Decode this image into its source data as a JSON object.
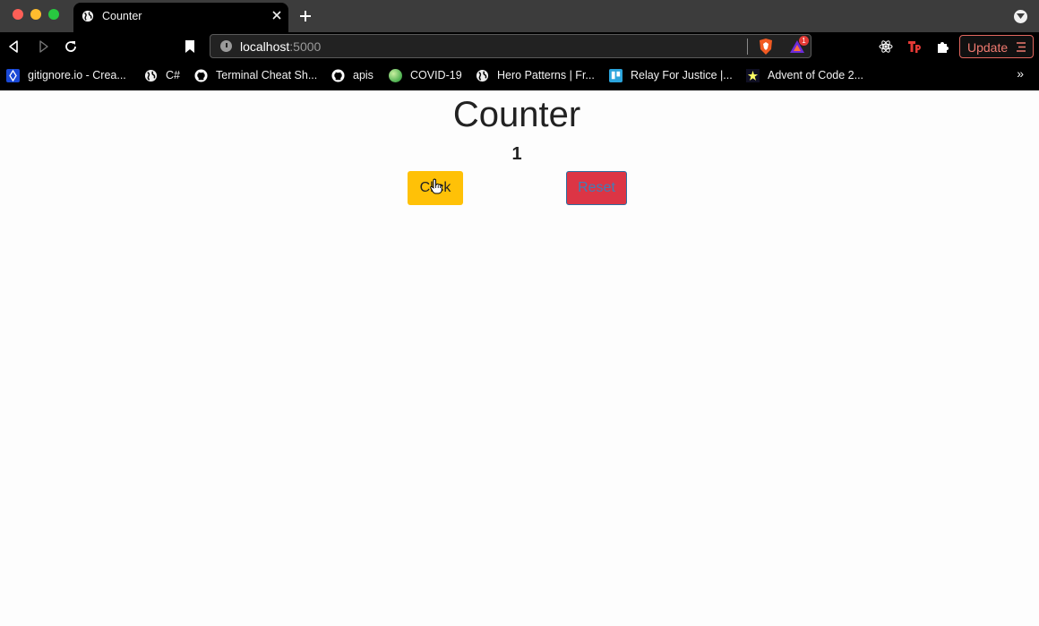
{
  "browser": {
    "active_tab": {
      "title": "Counter",
      "icon": "globe-icon"
    },
    "url": {
      "host": "localhost",
      "port": ":5000"
    },
    "rewards_badge": "1",
    "update_button": "Update",
    "bookmarks": [
      {
        "label": "gitignore.io - Crea...",
        "icon": "gitignore-icon"
      },
      {
        "label": "C#",
        "icon": "globe-icon"
      },
      {
        "label": "Terminal Cheat Sh...",
        "icon": "github-icon"
      },
      {
        "label": "apis",
        "icon": "github-icon"
      },
      {
        "label": "COVID-19",
        "icon": "green-globe-icon"
      },
      {
        "label": "Hero Patterns | Fr...",
        "icon": "globe-icon"
      },
      {
        "label": "Relay For Justice |...",
        "icon": "trello-icon"
      },
      {
        "label": "Advent of Code 2...",
        "icon": "star-icon"
      }
    ],
    "bookmarks_overflow": "»"
  },
  "page": {
    "title": "Counter",
    "count": "1",
    "click_button": "Click",
    "reset_button": "Reset"
  },
  "colors": {
    "click_button": "#ffc107",
    "reset_button": "#dc3545",
    "update_accent": "#f07a70"
  }
}
